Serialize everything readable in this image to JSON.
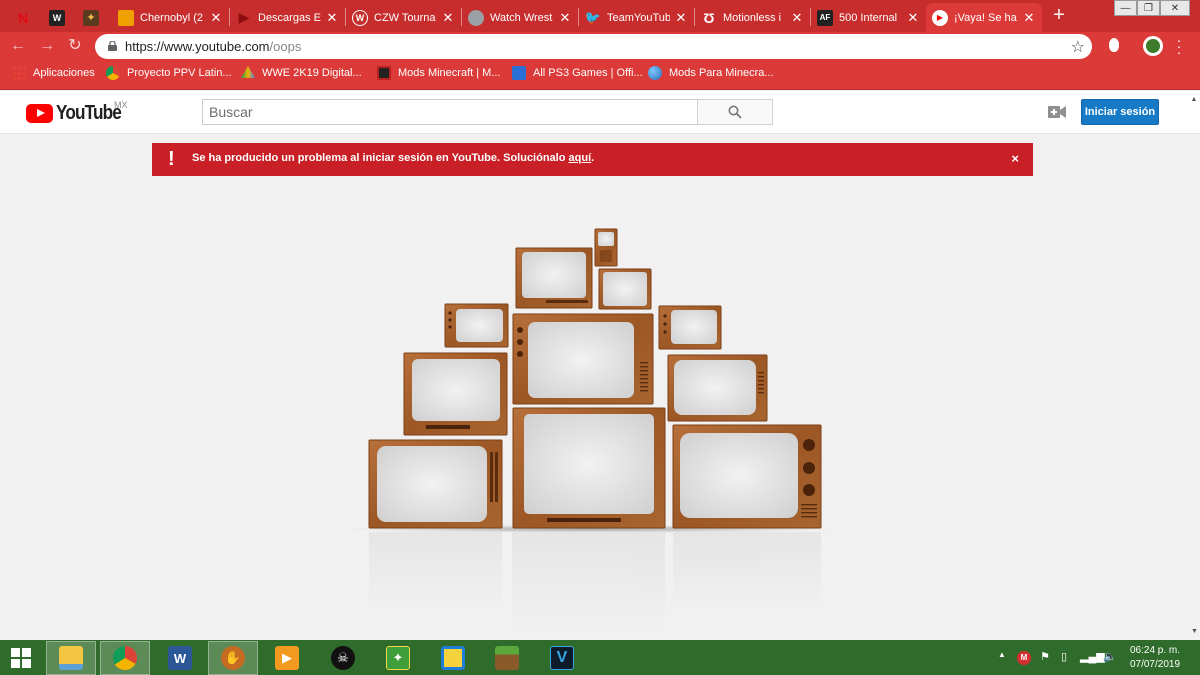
{
  "browser": {
    "tabs": [
      {
        "title": "",
        "icon": "netflix-icon",
        "pinned": true
      },
      {
        "title": "",
        "icon": "wwe-icon",
        "pinned": true
      },
      {
        "title": "",
        "icon": "game-icon",
        "pinned": true
      },
      {
        "title": "Chernobyl (2",
        "icon": "bookmark-icon"
      },
      {
        "title": "Descargas Ev",
        "icon": "play-icon"
      },
      {
        "title": "CZW Tourna",
        "icon": "wordpress-icon"
      },
      {
        "title": "Watch Wrest",
        "icon": "globe-icon"
      },
      {
        "title": "TeamYouTub",
        "icon": "twitter-icon"
      },
      {
        "title": "Motionless i",
        "icon": "motionless-icon"
      },
      {
        "title": "500 Internal",
        "icon": "af-icon"
      },
      {
        "title": "¡Vaya! Se ha",
        "icon": "youtube-icon",
        "active": true
      }
    ],
    "url_host": "https://www.youtube.com",
    "url_path": "/oops",
    "bookmarks": [
      {
        "label": "Aplicaciones",
        "icon": "apps-icon"
      },
      {
        "label": "Proyecto PPV Latin...",
        "icon": "chrome-icon"
      },
      {
        "label": "WWE 2K19 Digital...",
        "icon": "drive-icon"
      },
      {
        "label": "Mods Minecraft | M...",
        "icon": "minecraft-icon"
      },
      {
        "label": "All PS3 Games | Offi...",
        "icon": "ps3-icon"
      },
      {
        "label": "Mods Para Minecra...",
        "icon": "globe-icon"
      }
    ]
  },
  "youtube": {
    "logo_text": "YouTube",
    "region": "MX",
    "search_placeholder": "Buscar",
    "signin_label": "Iniciar sesión"
  },
  "alert": {
    "icon": "!",
    "message": "Se ha producido un problema al iniciar sesión en YouTube. Soluciónalo ",
    "link": "aquí",
    "suffix": ".",
    "close": "×"
  },
  "taskbar": {
    "apps": [
      "start-icon",
      "file-explorer-icon",
      "chrome-icon",
      "word-icon",
      "baseball-icon",
      "media-player-icon",
      "mask-icon",
      "game-link-icon",
      "geometry-dash-icon",
      "minecraft-icon",
      "vegas-icon"
    ],
    "clock_time": "06:24 p. m.",
    "clock_date": "07/07/2019"
  },
  "colors": {
    "chrome_red": "#dc3a38",
    "tab_strip": "#c62d2c",
    "alert_red": "#c82026",
    "signin_blue": "#167ac6",
    "taskbar_green": "#2f6b2a",
    "tv_wood": "#a65f2a"
  }
}
